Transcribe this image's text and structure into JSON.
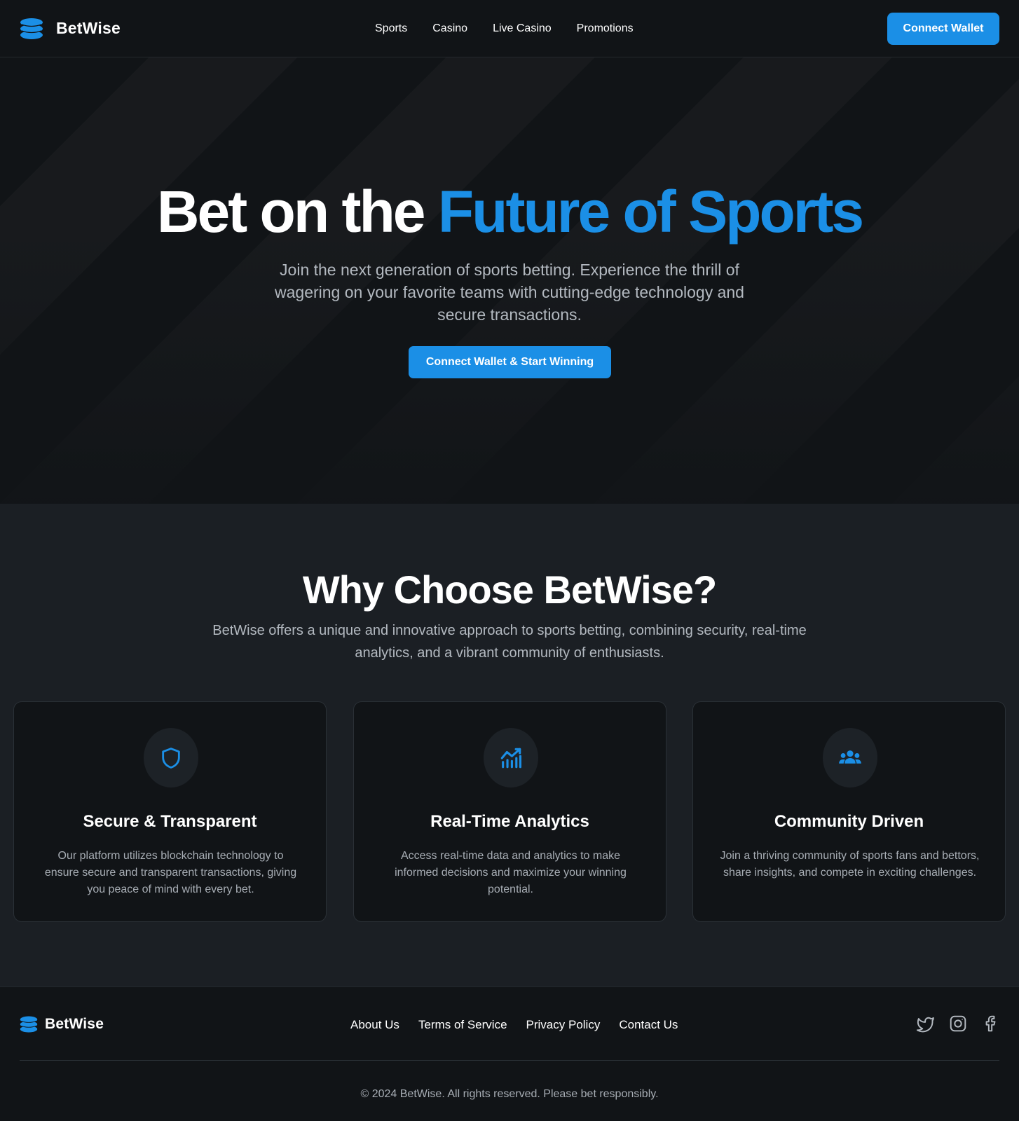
{
  "colors": {
    "accent": "#1b8fe6",
    "background": "#111417",
    "section_bg": "#1b1f24",
    "muted_text": "#b3b9c0"
  },
  "header": {
    "brand_name": "BetWise",
    "brand_icon": "stacked-coins-icon",
    "nav": [
      {
        "label": "Sports"
      },
      {
        "label": "Casino"
      },
      {
        "label": "Live Casino"
      },
      {
        "label": "Promotions"
      }
    ],
    "connect_label": "Connect Wallet"
  },
  "hero": {
    "title_main": "Bet on the ",
    "title_accent": "Future of Sports",
    "subtitle": "Join the next generation of sports betting. Experience the thrill of wagering on your favorite teams with cutting-edge technology and secure transactions.",
    "cta_label": "Connect Wallet & Start Winning"
  },
  "features": {
    "title": "Why Choose BetWise?",
    "subtitle": "BetWise offers a unique and innovative approach to sports betting, combining security, real-time analytics, and a vibrant community of enthusiasts.",
    "cards": [
      {
        "icon": "shield-icon",
        "title": "Secure & Transparent",
        "text": "Our platform utilizes blockchain technology to ensure secure and transparent transactions, giving you peace of mind with every bet."
      },
      {
        "icon": "chart-icon",
        "title": "Real-Time Analytics",
        "text": "Access real-time data and analytics to make informed decisions and maximize your winning potential."
      },
      {
        "icon": "users-icon",
        "title": "Community Driven",
        "text": "Join a thriving community of sports fans and bettors, share insights, and compete in exciting challenges."
      }
    ]
  },
  "footer": {
    "brand_name": "BetWise",
    "links": [
      {
        "label": "About Us"
      },
      {
        "label": "Terms of Service"
      },
      {
        "label": "Privacy Policy"
      },
      {
        "label": "Contact Us"
      }
    ],
    "social": [
      "twitter-icon",
      "instagram-icon",
      "facebook-icon"
    ],
    "copyright": "© 2024 BetWise. All rights reserved. Please bet responsibly."
  }
}
